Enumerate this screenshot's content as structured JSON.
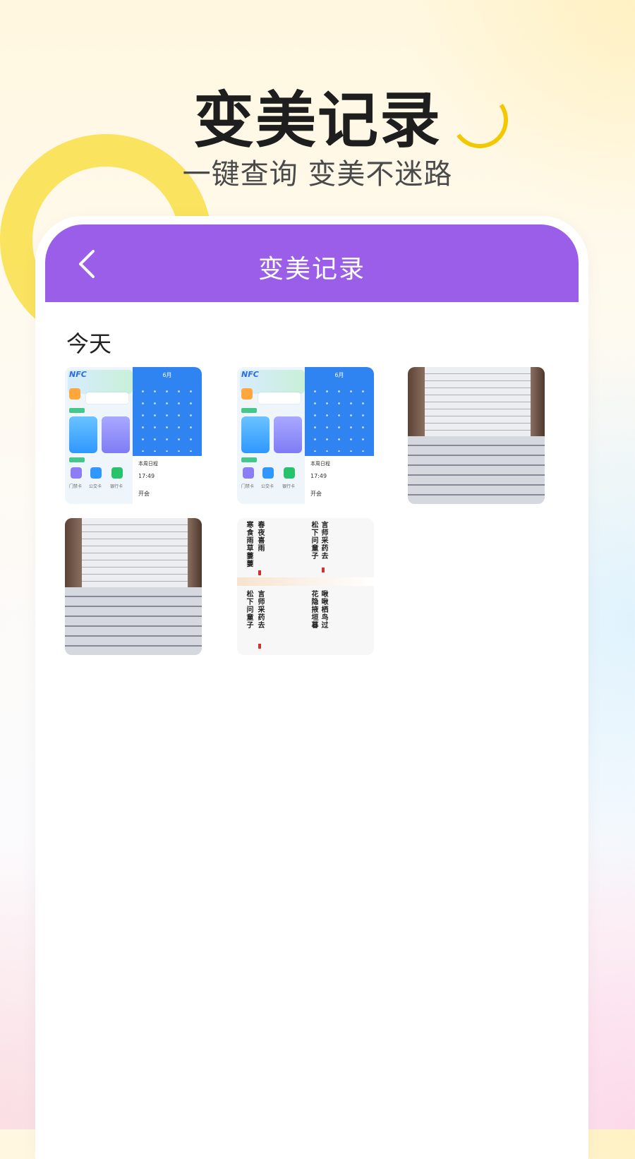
{
  "hero": {
    "title": "变美记录",
    "subtitle": "一键查询 变美不迷路"
  },
  "app_bar": {
    "title": "变美记录",
    "back_icon": "chevron-left-icon"
  },
  "section": {
    "label": "今天"
  },
  "thumbnails": [
    {
      "kind": "app-screenshot",
      "month": "6月",
      "brand": "NFC",
      "note_title": "本周日程",
      "time": "17:49",
      "event": "开会",
      "caps": [
        "门禁卡",
        "公交卡",
        "银行卡"
      ]
    },
    {
      "kind": "app-screenshot",
      "month": "6月",
      "brand": "NFC",
      "note_title": "本周日程",
      "time": "17:49",
      "event": "开会",
      "caps": [
        "门禁卡",
        "公交卡",
        "银行卡"
      ]
    },
    {
      "kind": "document-photo"
    },
    {
      "kind": "document-photo"
    },
    {
      "kind": "poem-cards",
      "poems": [
        "春夜喜雨",
        "松下问童子",
        "言师采药去",
        "寒食雨草萋萋",
        "松下问童子",
        "言师采药去",
        "花隐掖垣暮",
        "啾啾栖鸟过"
      ]
    }
  ],
  "colors": {
    "app_bar": "#9b5ee8",
    "ring": "#f9e050"
  }
}
